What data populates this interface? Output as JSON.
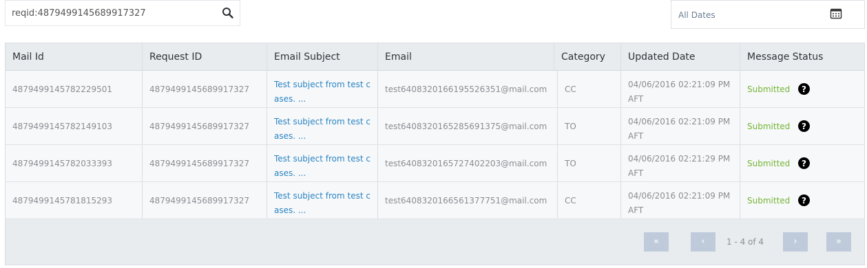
{
  "search": {
    "value": "reqid:4879499145689917327",
    "icon": "search-icon"
  },
  "date_filter": {
    "label": "All Dates",
    "icon": "calendar-icon"
  },
  "table": {
    "headers": [
      "Mail Id",
      "Request ID",
      "Email Subject",
      "Email",
      "Category",
      "Updated Date",
      "Message Status"
    ],
    "rows": [
      {
        "mail_id": "4879499145782229501",
        "request_id": "4879499145689917327",
        "subject": "Test subject from test cases. ...",
        "email": "test6408320166195526351@mail.com",
        "category": "CC",
        "updated": "04/06/2016 02:21:09 PM AFT",
        "status": "Submitted"
      },
      {
        "mail_id": "4879499145782149103",
        "request_id": "4879499145689917327",
        "subject": "Test subject from test cases. ...",
        "email": "test6408320165285691375@mail.com",
        "category": "TO",
        "updated": "04/06/2016 02:21:09 PM AFT",
        "status": "Submitted"
      },
      {
        "mail_id": "4879499145782033393",
        "request_id": "4879499145689917327",
        "subject": "Test subject from test cases. ...",
        "email": "test6408320165727402203@mail.com",
        "category": "TO",
        "updated": "04/06/2016 02:21:29 PM AFT",
        "status": "Submitted"
      },
      {
        "mail_id": "4879499145781815293",
        "request_id": "4879499145689917327",
        "subject": "Test subject from test cases. ...",
        "email": "test6408320166561377751@mail.com",
        "category": "CC",
        "updated": "04/06/2016 02:21:09 PM AFT",
        "status": "Submitted"
      }
    ]
  },
  "pagination": {
    "first": "«",
    "prev": "‹",
    "next": "›",
    "last": "»",
    "info": "1 - 4 of 4"
  },
  "colors": {
    "link": "#2a84c2",
    "status": "#74b535",
    "pager": "#bfcbda"
  }
}
